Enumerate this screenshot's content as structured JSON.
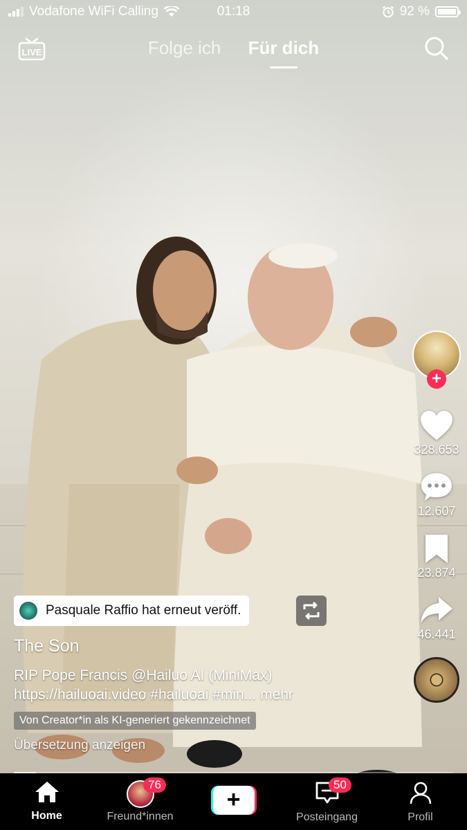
{
  "status_bar": {
    "carrier": "Vodafone WiFi Calling",
    "time": "01:18",
    "battery": "92 %"
  },
  "top_nav": {
    "live_icon": "live-tv-icon",
    "tabs": [
      {
        "label": "Folge ich",
        "active": false
      },
      {
        "label": "Für dich",
        "active": true
      }
    ],
    "search_icon": "search-icon"
  },
  "video": {
    "scene": "smiling-pair-photo"
  },
  "actions": {
    "likes": "328.653",
    "comments": "12.607",
    "saves": "23.874",
    "shares": "46.441",
    "follow_symbol": "+"
  },
  "repost": {
    "text": "Pasquale Raffio hat erneut veröff."
  },
  "caption": {
    "title": "The Son",
    "line1": "RIP Pope Francis  @Hailuo AI (MiniMax)",
    "line2": "https://hailuoai.video #hailuoai #min...",
    "more": "mehr",
    "ai_label": "Von Creator*in als KI-generiert gekennzeichnet",
    "translate": "Übersetzung anzeigen"
  },
  "progress": 0.05,
  "bottom_nav": {
    "home": "Home",
    "friends": "Freund*innen",
    "friends_badge": "76",
    "create_symbol": "+",
    "inbox": "Posteingang",
    "inbox_badge": "50",
    "profile": "Profil"
  },
  "colors": {
    "accent": "#fe2c55",
    "cyan": "#25f4ee",
    "nav_bg": "#000000"
  }
}
